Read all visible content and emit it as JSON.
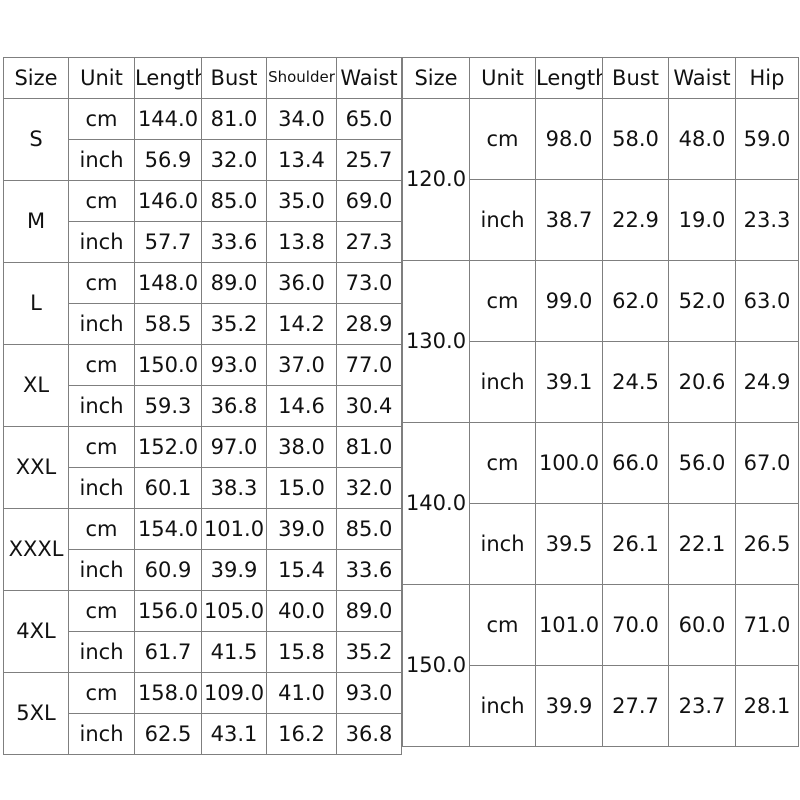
{
  "chart_data": {
    "type": "table",
    "title": "",
    "tables": [
      {
        "name": "tops-size-chart",
        "columns": [
          "Size",
          "Unit",
          "Length",
          "Bust",
          "Shoulder",
          "Waist"
        ],
        "unit_labels": [
          "cm",
          "inch"
        ],
        "rows": [
          {
            "size": "S",
            "cm": [
              "144.0",
              "81.0",
              "34.0",
              "65.0"
            ],
            "inch": [
              "56.9",
              "32.0",
              "13.4",
              "25.7"
            ]
          },
          {
            "size": "M",
            "cm": [
              "146.0",
              "85.0",
              "35.0",
              "69.0"
            ],
            "inch": [
              "57.7",
              "33.6",
              "13.8",
              "27.3"
            ]
          },
          {
            "size": "L",
            "cm": [
              "148.0",
              "89.0",
              "36.0",
              "73.0"
            ],
            "inch": [
              "58.5",
              "35.2",
              "14.2",
              "28.9"
            ]
          },
          {
            "size": "XL",
            "cm": [
              "150.0",
              "93.0",
              "37.0",
              "77.0"
            ],
            "inch": [
              "59.3",
              "36.8",
              "14.6",
              "30.4"
            ]
          },
          {
            "size": "XXL",
            "cm": [
              "152.0",
              "97.0",
              "38.0",
              "81.0"
            ],
            "inch": [
              "60.1",
              "38.3",
              "15.0",
              "32.0"
            ]
          },
          {
            "size": "XXXL",
            "cm": [
              "154.0",
              "101.0",
              "39.0",
              "85.0"
            ],
            "inch": [
              "60.9",
              "39.9",
              "15.4",
              "33.6"
            ]
          },
          {
            "size": "4XL",
            "cm": [
              "156.0",
              "105.0",
              "40.0",
              "89.0"
            ],
            "inch": [
              "61.7",
              "41.5",
              "15.8",
              "35.2"
            ]
          },
          {
            "size": "5XL",
            "cm": [
              "158.0",
              "109.0",
              "41.0",
              "93.0"
            ],
            "inch": [
              "62.5",
              "43.1",
              "16.2",
              "36.8"
            ]
          }
        ]
      },
      {
        "name": "bottoms-size-chart",
        "columns": [
          "Size",
          "Unit",
          "Length",
          "Bust",
          "Waist",
          "Hip"
        ],
        "unit_labels": [
          "cm",
          "inch"
        ],
        "rows": [
          {
            "size": "120.0",
            "cm": [
              "98.0",
              "58.0",
              "48.0",
              "59.0"
            ],
            "inch": [
              "38.7",
              "22.9",
              "19.0",
              "23.3"
            ]
          },
          {
            "size": "130.0",
            "cm": [
              "99.0",
              "62.0",
              "52.0",
              "63.0"
            ],
            "inch": [
              "39.1",
              "24.5",
              "20.6",
              "24.9"
            ]
          },
          {
            "size": "140.0",
            "cm": [
              "100.0",
              "66.0",
              "56.0",
              "67.0"
            ],
            "inch": [
              "39.5",
              "26.1",
              "22.1",
              "26.5"
            ]
          },
          {
            "size": "150.0",
            "cm": [
              "101.0",
              "70.0",
              "60.0",
              "71.0"
            ],
            "inch": [
              "39.9",
              "27.7",
              "23.7",
              "28.1"
            ]
          }
        ]
      }
    ],
    "colors": {
      "background": "#ffffff",
      "grid_line": "#7f7f7f",
      "text": "#111111"
    }
  }
}
